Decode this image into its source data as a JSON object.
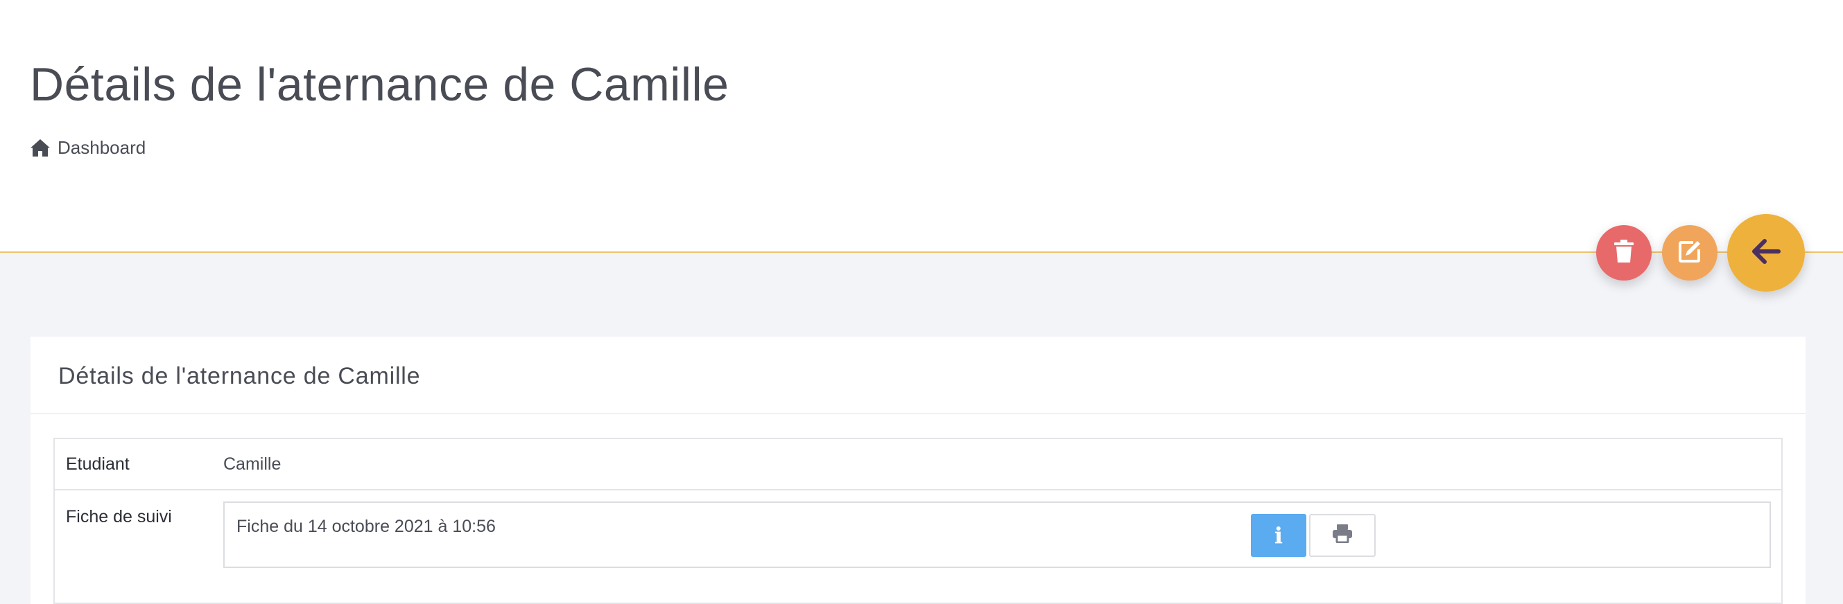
{
  "header": {
    "title": "Détails de l'aternance de Camille",
    "breadcrumb": {
      "icon": "home-icon",
      "label": "Dashboard"
    }
  },
  "actions": {
    "delete": {
      "icon": "trash-icon",
      "color": "#e8696a"
    },
    "edit": {
      "icon": "edit-icon",
      "color": "#f0a55a"
    },
    "back": {
      "icon": "arrow-left-icon",
      "color": "#eeb13b"
    }
  },
  "card": {
    "title": "Détails de l'aternance de Camille",
    "rows": {
      "student": {
        "label": "Etudiant",
        "value": "Camille"
      },
      "fiche": {
        "label": "Fiche de suivi",
        "entry": "Fiche du 14 octobre 2021 à 10:56",
        "info_button": {
          "icon": "info-icon",
          "glyph": "i",
          "color": "#5aabef"
        },
        "print_button": {
          "icon": "print-icon"
        }
      }
    }
  },
  "colors": {
    "accent_line": "#f0c36b",
    "page_background": "#f3f4f8"
  }
}
